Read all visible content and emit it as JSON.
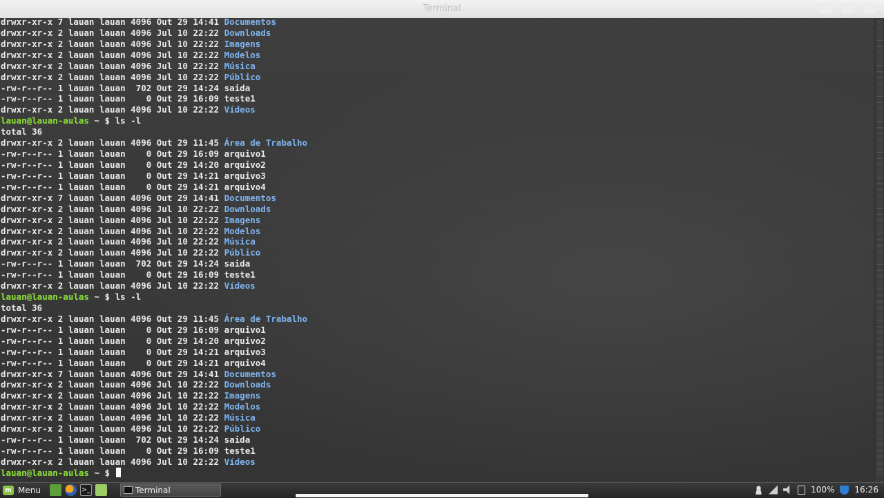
{
  "window": {
    "title": "Terminal"
  },
  "prompt": {
    "user_host": "lauan@lauan-aulas",
    "path_symbol": "~ $",
    "last_command": "ls -l"
  },
  "terminal": {
    "lines": [
      {
        "text": "drwxr-xr-x 7 lauan lauan 4096 Out 29 14:41 ",
        "name": "Documentos",
        "type": "dir"
      },
      {
        "text": "drwxr-xr-x 2 lauan lauan 4096 Jul 10 22:22 ",
        "name": "Downloads",
        "type": "dir"
      },
      {
        "text": "drwxr-xr-x 2 lauan lauan 4096 Jul 10 22:22 ",
        "name": "Imagens",
        "type": "dir"
      },
      {
        "text": "drwxr-xr-x 2 lauan lauan 4096 Jul 10 22:22 ",
        "name": "Modelos",
        "type": "dir"
      },
      {
        "text": "drwxr-xr-x 2 lauan lauan 4096 Jul 10 22:22 ",
        "name": "Música",
        "type": "dir"
      },
      {
        "text": "drwxr-xr-x 2 lauan lauan 4096 Jul 10 22:22 ",
        "name": "Público",
        "type": "dir"
      },
      {
        "text": "-rw-r--r-- 1 lauan lauan  702 Out 29 14:24 ",
        "name": "saida",
        "type": "file"
      },
      {
        "text": "-rw-r--r-- 1 lauan lauan    0 Out 29 16:09 ",
        "name": "teste1",
        "type": "file"
      },
      {
        "text": "drwxr-xr-x 2 lauan lauan 4096 Jul 10 22:22 ",
        "name": "Vídeos",
        "type": "dir"
      },
      {
        "text": "lauan@lauan-aulas",
        "name": "~ $ ls -l",
        "type": "prompt"
      },
      {
        "text": "total 36",
        "name": "",
        "type": "plain"
      },
      {
        "text": "drwxr-xr-x 2 lauan lauan 4096 Out 29 11:45 ",
        "name": "Área de Trabalho",
        "type": "dir"
      },
      {
        "text": "-rw-r--r-- 1 lauan lauan    0 Out 29 16:09 ",
        "name": "arquivo1",
        "type": "file"
      },
      {
        "text": "-rw-r--r-- 1 lauan lauan    0 Out 29 14:20 ",
        "name": "arquivo2",
        "type": "file"
      },
      {
        "text": "-rw-r--r-- 1 lauan lauan    0 Out 29 14:21 ",
        "name": "arquivo3",
        "type": "file"
      },
      {
        "text": "-rw-r--r-- 1 lauan lauan    0 Out 29 14:21 ",
        "name": "arquivo4",
        "type": "file"
      },
      {
        "text": "drwxr-xr-x 7 lauan lauan 4096 Out 29 14:41 ",
        "name": "Documentos",
        "type": "dir"
      },
      {
        "text": "drwxr-xr-x 2 lauan lauan 4096 Jul 10 22:22 ",
        "name": "Downloads",
        "type": "dir"
      },
      {
        "text": "drwxr-xr-x 2 lauan lauan 4096 Jul 10 22:22 ",
        "name": "Imagens",
        "type": "dir"
      },
      {
        "text": "drwxr-xr-x 2 lauan lauan 4096 Jul 10 22:22 ",
        "name": "Modelos",
        "type": "dir"
      },
      {
        "text": "drwxr-xr-x 2 lauan lauan 4096 Jul 10 22:22 ",
        "name": "Música",
        "type": "dir"
      },
      {
        "text": "drwxr-xr-x 2 lauan lauan 4096 Jul 10 22:22 ",
        "name": "Público",
        "type": "dir"
      },
      {
        "text": "-rw-r--r-- 1 lauan lauan  702 Out 29 14:24 ",
        "name": "saida",
        "type": "file"
      },
      {
        "text": "-rw-r--r-- 1 lauan lauan    0 Out 29 16:09 ",
        "name": "teste1",
        "type": "file"
      },
      {
        "text": "drwxr-xr-x 2 lauan lauan 4096 Jul 10 22:22 ",
        "name": "Vídeos",
        "type": "dir"
      },
      {
        "text": "lauan@lauan-aulas",
        "name": "~ $ ls -l",
        "type": "prompt"
      },
      {
        "text": "total 36",
        "name": "",
        "type": "plain"
      },
      {
        "text": "drwxr-xr-x 2 lauan lauan 4096 Out 29 11:45 ",
        "name": "Área de Trabalho",
        "type": "dir"
      },
      {
        "text": "-rw-r--r-- 1 lauan lauan    0 Out 29 16:09 ",
        "name": "arquivo1",
        "type": "file"
      },
      {
        "text": "-rw-r--r-- 1 lauan lauan    0 Out 29 14:20 ",
        "name": "arquivo2",
        "type": "file"
      },
      {
        "text": "-rw-r--r-- 1 lauan lauan    0 Out 29 14:21 ",
        "name": "arquivo3",
        "type": "file"
      },
      {
        "text": "-rw-r--r-- 1 lauan lauan    0 Out 29 14:21 ",
        "name": "arquivo4",
        "type": "file"
      },
      {
        "text": "drwxr-xr-x 7 lauan lauan 4096 Out 29 14:41 ",
        "name": "Documentos",
        "type": "dir"
      },
      {
        "text": "drwxr-xr-x 2 lauan lauan 4096 Jul 10 22:22 ",
        "name": "Downloads",
        "type": "dir"
      },
      {
        "text": "drwxr-xr-x 2 lauan lauan 4096 Jul 10 22:22 ",
        "name": "Imagens",
        "type": "dir"
      },
      {
        "text": "drwxr-xr-x 2 lauan lauan 4096 Jul 10 22:22 ",
        "name": "Modelos",
        "type": "dir"
      },
      {
        "text": "drwxr-xr-x 2 lauan lauan 4096 Jul 10 22:22 ",
        "name": "Música",
        "type": "dir"
      },
      {
        "text": "drwxr-xr-x 2 lauan lauan 4096 Jul 10 22:22 ",
        "name": "Público",
        "type": "dir"
      },
      {
        "text": "-rw-r--r-- 1 lauan lauan  702 Out 29 14:24 ",
        "name": "saida",
        "type": "file"
      },
      {
        "text": "-rw-r--r-- 1 lauan lauan    0 Out 29 16:09 ",
        "name": "teste1",
        "type": "file"
      },
      {
        "text": "drwxr-xr-x 2 lauan lauan 4096 Jul 10 22:22 ",
        "name": "Vídeos",
        "type": "dir"
      },
      {
        "text": "lauan@lauan-aulas",
        "name": "~ $",
        "type": "prompt-cursor"
      }
    ]
  },
  "taskbar": {
    "menu_label": "Menu",
    "window_button_label": "Terminal",
    "battery": "100%",
    "clock": "16:26"
  },
  "colors": {
    "directory": "#7eb4f0",
    "prompt_user": "#8ae234",
    "text": "#eaeaea",
    "background": "#3b3b3b"
  },
  "icons": {
    "menu": "mint-menu-icon",
    "launchers": [
      "show-desktop-icon",
      "firefox-icon",
      "terminal-icon",
      "files-icon"
    ],
    "tray": [
      "user-icon",
      "network-icon",
      "volume-icon",
      "battery-icon",
      "update-shield-icon"
    ]
  }
}
